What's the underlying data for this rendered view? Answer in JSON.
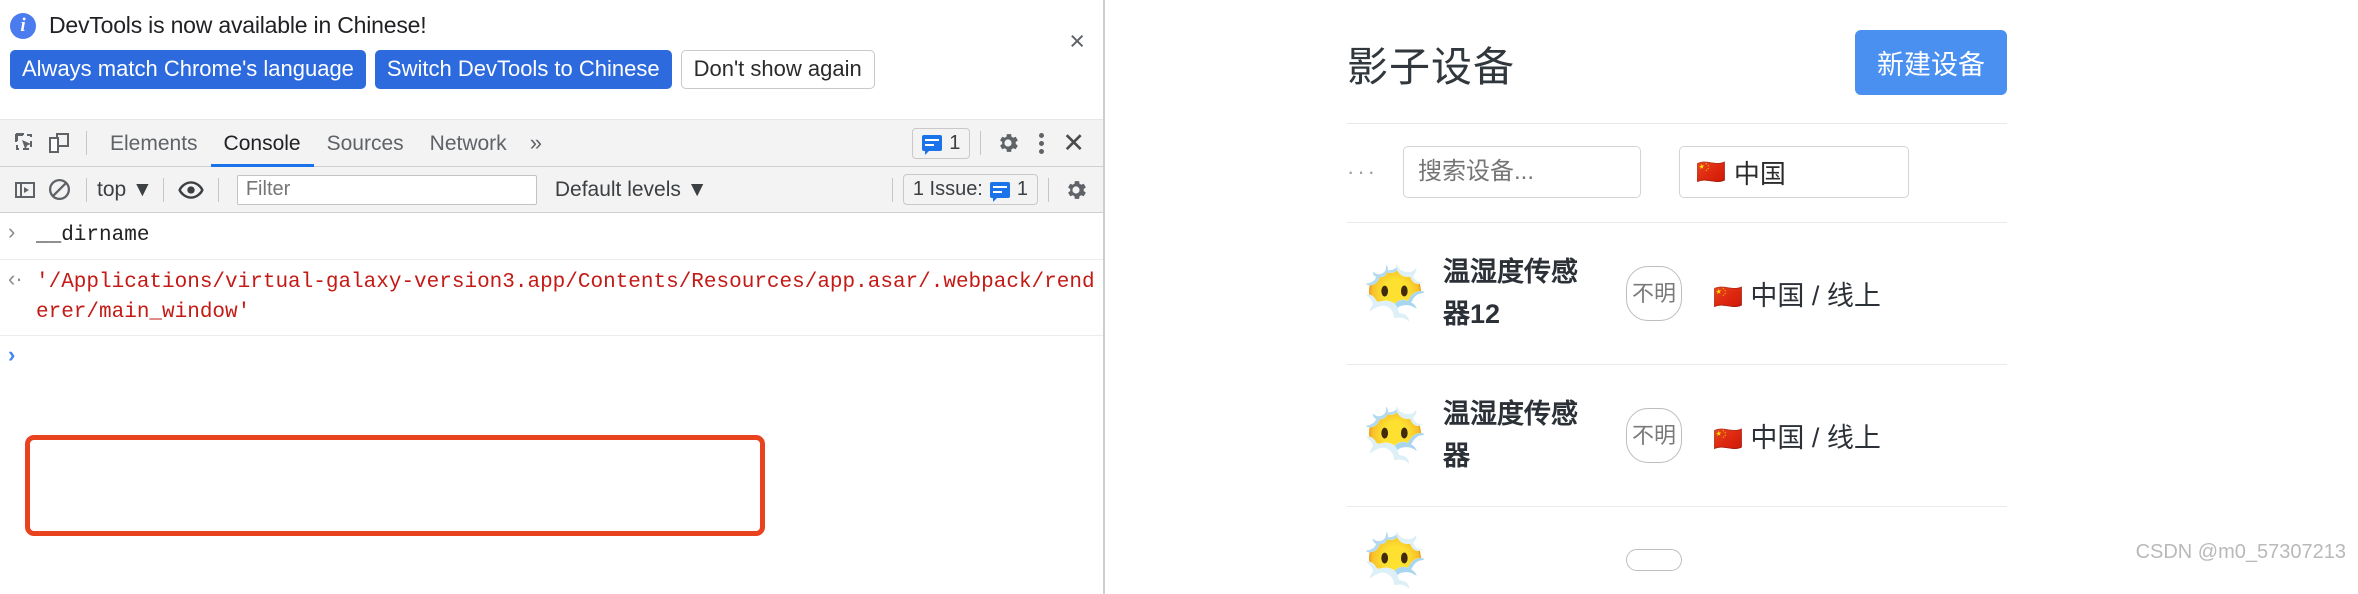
{
  "devtools": {
    "notification": {
      "icon": "info-icon",
      "message": "DevTools is now available in Chinese!",
      "primary_button": "Always match Chrome's language",
      "secondary_button": "Switch DevTools to Chinese",
      "tertiary_button": "Don't show again",
      "close_label": "×"
    },
    "tabs": [
      {
        "label": "Elements",
        "active": false
      },
      {
        "label": "Console",
        "active": true
      },
      {
        "label": "Sources",
        "active": false
      },
      {
        "label": "Network",
        "active": false
      }
    ],
    "tab_overflow": "»",
    "toolbar_icons": {
      "inspect": "inspect-element-icon",
      "device": "device-toolbar-icon",
      "settings": "gear-icon",
      "more": "kebab-menu-icon",
      "close": "close-icon"
    },
    "message_count": "1",
    "console_toolbar": {
      "sidebar_toggle": "console-sidebar-icon",
      "clear": "clear-console-icon",
      "context": "top",
      "context_caret": "▼",
      "eye": "live-expression-icon",
      "filter_placeholder": "Filter",
      "filter_value": "",
      "levels": "Default levels",
      "levels_caret": "▼",
      "issues_label": "1 Issue:",
      "issues_count": "1",
      "settings": "gear-icon"
    },
    "console_lines": [
      {
        "gutter": "›",
        "gutter_style": "grey",
        "text": "__dirname",
        "kind": "input"
      },
      {
        "gutter": "‹·",
        "gutter_style": "grey",
        "text": "'/Applications/virtual-galaxy-version3.app/Contents/Resources/app.asar/.webpack/renderer/main_window'",
        "kind": "output"
      }
    ],
    "prompt_caret": "›",
    "highlight_color": "#e8421f"
  },
  "webapp": {
    "title": "影子设备",
    "new_device_button": "新建设备",
    "accent_color": "#4a90f0",
    "filters": {
      "ellipsis": "···",
      "search_placeholder": "搜索设备...",
      "search_value": "",
      "country_flag": "🇨🇳",
      "country_label": "中国"
    },
    "devices": [
      {
        "avatar": "😶‍🌫️",
        "name": "温湿度传感器12",
        "status": "不明",
        "flag": "🇨🇳",
        "location": "中国 / 线上"
      },
      {
        "avatar": "😶‍🌫️",
        "name": "温湿度传感器",
        "status": "不明",
        "flag": "🇨🇳",
        "location": "中国 / 线上"
      },
      {
        "avatar": "😶‍🌫️",
        "name": "",
        "status": "",
        "flag": "",
        "location": ""
      }
    ]
  },
  "watermark": "CSDN @m0_57307213"
}
